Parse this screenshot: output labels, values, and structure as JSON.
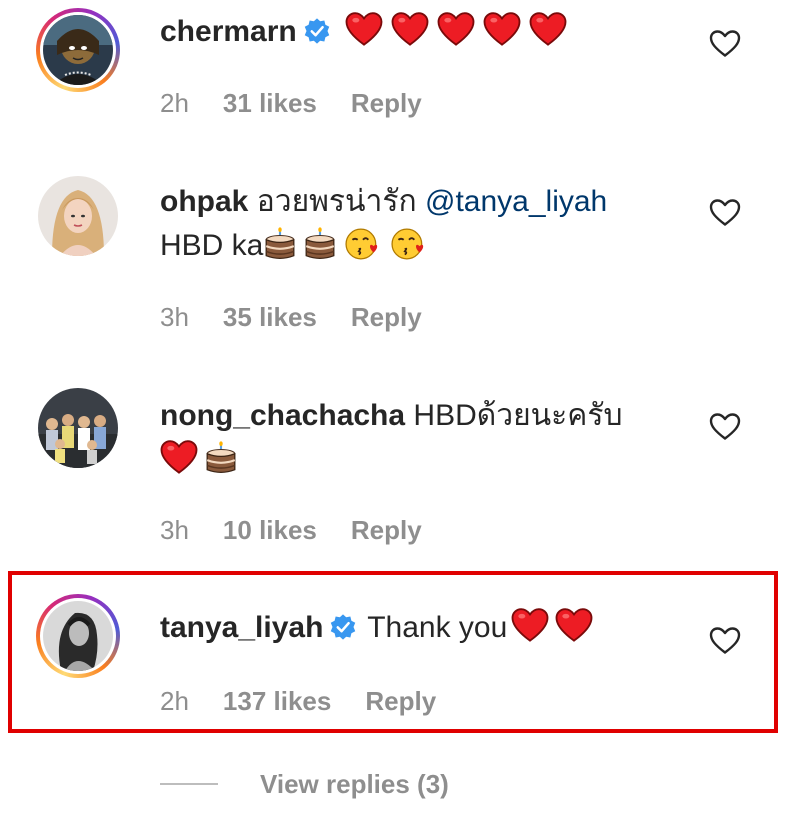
{
  "comments": [
    {
      "username": "chermarn",
      "verified": true,
      "text": "",
      "emojis": [
        "heart",
        "heart",
        "heart",
        "heart",
        "heart"
      ],
      "time": "2h",
      "likes": "31 likes",
      "reply": "Reply"
    },
    {
      "username": "ohpak",
      "verified": false,
      "text_pre": "อวยพรน่ารัก",
      "mention": "@tanya_liyah",
      "line2_text": "HBD ka",
      "emojis": [
        "cake",
        "cake",
        "kiss",
        "kiss"
      ],
      "time": "3h",
      "likes": "35 likes",
      "reply": "Reply"
    },
    {
      "username": "nong_chachacha",
      "verified": false,
      "text": "HBDด้วยนะครับ",
      "emojis": [
        "heart",
        "cake"
      ],
      "time": "3h",
      "likes": "10 likes",
      "reply": "Reply"
    },
    {
      "username": "tanya_liyah",
      "verified": true,
      "text": "Thank you",
      "emojis": [
        "heart",
        "heart"
      ],
      "time": "2h",
      "likes": "137 likes",
      "reply": "Reply",
      "highlighted": true
    }
  ],
  "view_replies": "View replies (3)",
  "colors": {
    "highlight_border": "#e00000",
    "verified_blue": "#3897f0",
    "heart_red": "#ed1c24",
    "meta_gray": "#8e8e8e"
  }
}
